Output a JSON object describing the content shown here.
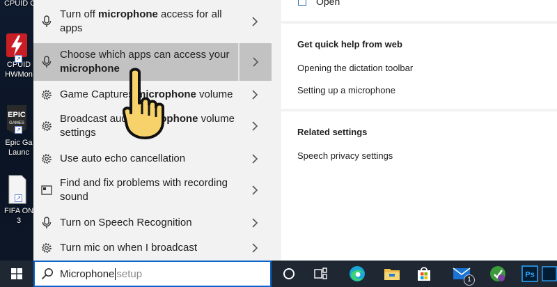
{
  "desktop": {
    "icons": [
      {
        "caption_lines": [
          "CPUID C"
        ],
        "icon": "cpuid-icon"
      },
      {
        "caption_lines": [
          "CPUID",
          "HWMon"
        ],
        "icon": "hwmonitor-icon"
      },
      {
        "caption_lines": [
          "Epic Ga",
          "Launc"
        ],
        "icon": "epic-games-icon",
        "tile_text": "EPIC",
        "tile_sub": "GAMES"
      },
      {
        "caption_lines": [
          "FIFA ON",
          "3"
        ],
        "icon": "fifa-online-icon"
      }
    ]
  },
  "results": [
    {
      "icon": "microphone-icon",
      "pre": "Turn off ",
      "bold": "microphone",
      "post": " access for all apps",
      "selected": false
    },
    {
      "icon": "microphone-icon",
      "pre": "Choose which apps can access your ",
      "bold": "microphone",
      "post": "",
      "selected": true
    },
    {
      "icon": "gear-icon",
      "pre": "Game Captures ",
      "bold": "microphone",
      "post": " volume",
      "selected": false
    },
    {
      "icon": "gear-icon",
      "pre": "Broadcast audio ",
      "bold": "microphone",
      "post": " volume settings",
      "selected": false
    },
    {
      "icon": "gear-icon",
      "pre": "Use auto echo cancellation",
      "bold": "",
      "post": "",
      "selected": false
    },
    {
      "icon": "troubleshoot-icon",
      "pre": "Find and fix problems with recording sound",
      "bold": "",
      "post": "",
      "selected": false
    },
    {
      "icon": "microphone-icon",
      "pre": "Turn on Speech Recognition",
      "bold": "",
      "post": "",
      "selected": false
    },
    {
      "icon": "gear-icon",
      "pre": "Turn mic on when I broadcast",
      "bold": "",
      "post": "",
      "selected": false
    }
  ],
  "preview": {
    "open_label": "Open",
    "web_help": {
      "title": "Get quick help from web",
      "links": [
        "Opening the dictation toolbar",
        "Setting up a microphone"
      ]
    },
    "related": {
      "title": "Related settings",
      "links": [
        "Speech privacy settings"
      ]
    }
  },
  "taskbar": {
    "search_query": "Microphone",
    "search_placeholder": " setup",
    "mail_badge": "1",
    "photoshop_label": "Ps",
    "icons": [
      "windows-start-icon",
      "cortana-icon",
      "task-view-icon",
      "edge-icon",
      "file-explorer-icon",
      "store-icon",
      "mail-icon",
      "app-icon",
      "photoshop-icon",
      "photoshop-icon"
    ]
  },
  "colors": {
    "accent": "#0a64c8",
    "selected_row": "#c2c2c2",
    "panel_bg": "#f2f2f2",
    "taskbar_bg": "#1f2733"
  }
}
